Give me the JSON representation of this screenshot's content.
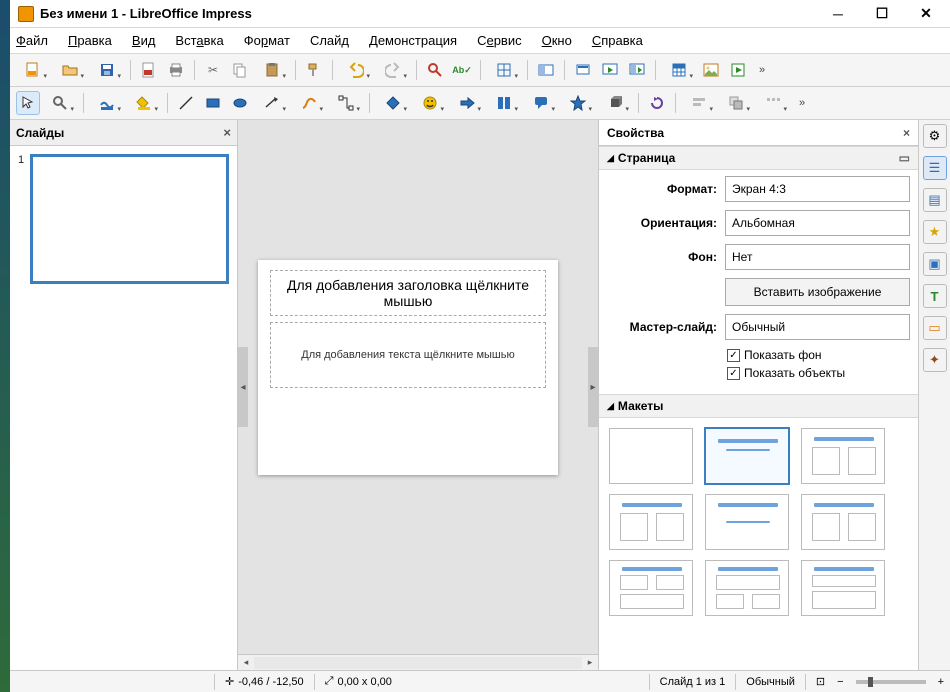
{
  "window": {
    "title": "Без имени 1 - LibreOffice Impress"
  },
  "menus": [
    "Файл",
    "Правка",
    "Вид",
    "Вставка",
    "Формат",
    "Слайд",
    "Демонстрация",
    "Сервис",
    "Окно",
    "Справка"
  ],
  "slides_panel": {
    "title": "Слайды",
    "slide_number": "1"
  },
  "slide": {
    "title_placeholder": "Для добавления заголовка щёлкните мышью",
    "body_placeholder": "Для добавления текста щёлкните мышью"
  },
  "props": {
    "panel_title": "Свойства",
    "page_section": "Страница",
    "labels": {
      "format": "Формат:",
      "orientation": "Ориентация:",
      "background": "Фон:",
      "master": "Мастер-слайд:"
    },
    "values": {
      "format": "Экран 4:3",
      "orientation": "Альбомная",
      "background": "Нет",
      "master": "Обычный"
    },
    "insert_image": "Вставить изображение",
    "show_bg": "Показать фон",
    "show_objects": "Показать объекты",
    "layouts_section": "Макеты"
  },
  "status": {
    "coords": "-0,46 / -12,50",
    "size": "0,00 x 0,00",
    "slide_info": "Слайд 1 из 1",
    "master": "Обычный"
  }
}
